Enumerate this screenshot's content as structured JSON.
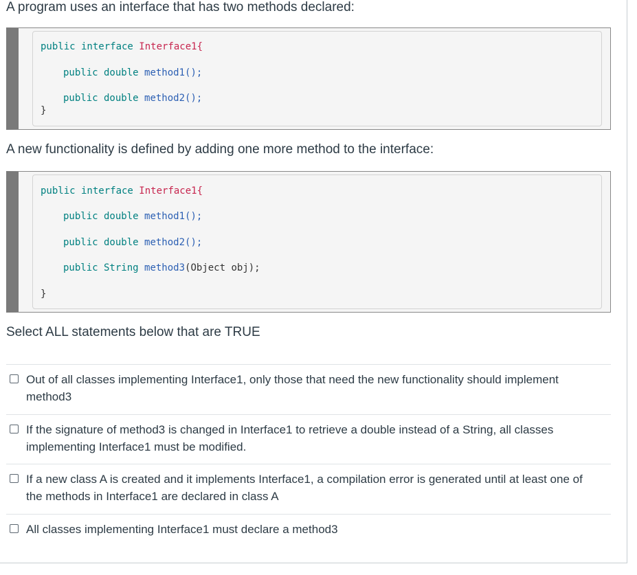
{
  "question": {
    "intro": "A program uses an interface that has two methods declared:",
    "middle": "A new functionality is defined by adding one more method to the interface:",
    "instruction": "Select ALL statements below that are TRUE"
  },
  "code1": {
    "l1": {
      "kw": "public interface ",
      "cls": "Interface1{"
    },
    "l2": {
      "kw": "public double ",
      "m": "method1();"
    },
    "l3": {
      "kw": "public double ",
      "m": "method2();"
    },
    "close": "}"
  },
  "code2": {
    "l1": {
      "kw": "public interface ",
      "cls": "Interface1{"
    },
    "l2": {
      "kw": "public double ",
      "m": "method1();"
    },
    "l3": {
      "kw": "public double ",
      "m": "method2();"
    },
    "l4": {
      "kw": "public String ",
      "m": "method3",
      "rest": "(Object obj);"
    },
    "close": "}"
  },
  "options": [
    {
      "label": "Out of all classes implementing Interface1, only those that need the new functionality should implement method3",
      "checked": false
    },
    {
      "label": "If the signature of method3 is changed in Interface1 to retrieve a double instead of a String, all classes implementing Interface1 must be modified.",
      "checked": false
    },
    {
      "label": "If a new class A is created and it implements Interface1, a compilation error is generated until at least one of the methods in Interface1 are declared in class A",
      "checked": false
    },
    {
      "label": "All classes implementing Interface1 must declare a method3",
      "checked": false
    }
  ]
}
